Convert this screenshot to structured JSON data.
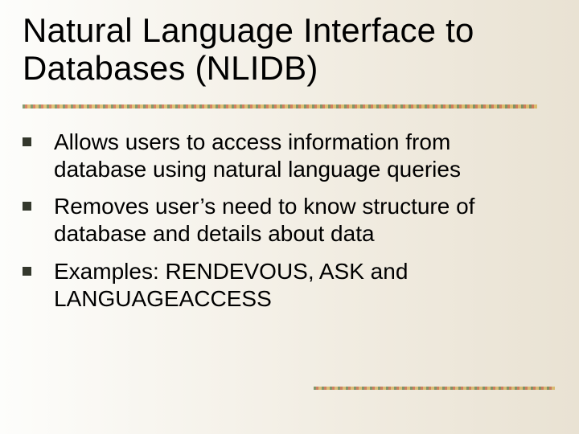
{
  "title": "Natural Language Interface to Databases (NLIDB)",
  "bullets": [
    "Allows users to access information from database using natural language queries",
    "Removes user’s need to know structure of database and details about data",
    "Examples: RENDEVOUS, ASK and LANGUAGEACCESS"
  ]
}
